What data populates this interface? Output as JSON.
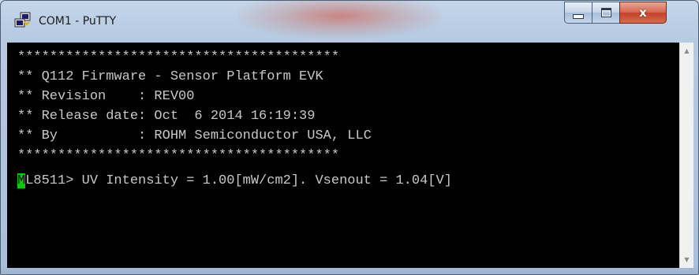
{
  "window": {
    "title": "COM1 - PuTTY",
    "app_icon": "putty-icon",
    "controls": {
      "minimize_icon": "minimize-icon",
      "maximize_icon": "maximize-icon",
      "close_label": "x"
    }
  },
  "terminal": {
    "lines": [
      "****************************************",
      "** Q112 Firmware - Sensor Platform EVK",
      "** Revision    : REV00",
      "** Release date: Oct  6 2014 16:19:39",
      "** By          : ROHM Semiconductor USA, LLC",
      "****************************************"
    ],
    "prompt": {
      "cursor_char": "M",
      "rest": "L8511> UV Intensity = 1.00[mW/cm2]. Vsenout = 1.04[V]"
    },
    "colors": {
      "background": "#000000",
      "text": "#c8c8c8",
      "cursor": "#00cc00"
    }
  },
  "scrollbar": {
    "up_icon": "scroll-up-arrow-icon",
    "down_icon": "scroll-down-arrow-icon"
  }
}
